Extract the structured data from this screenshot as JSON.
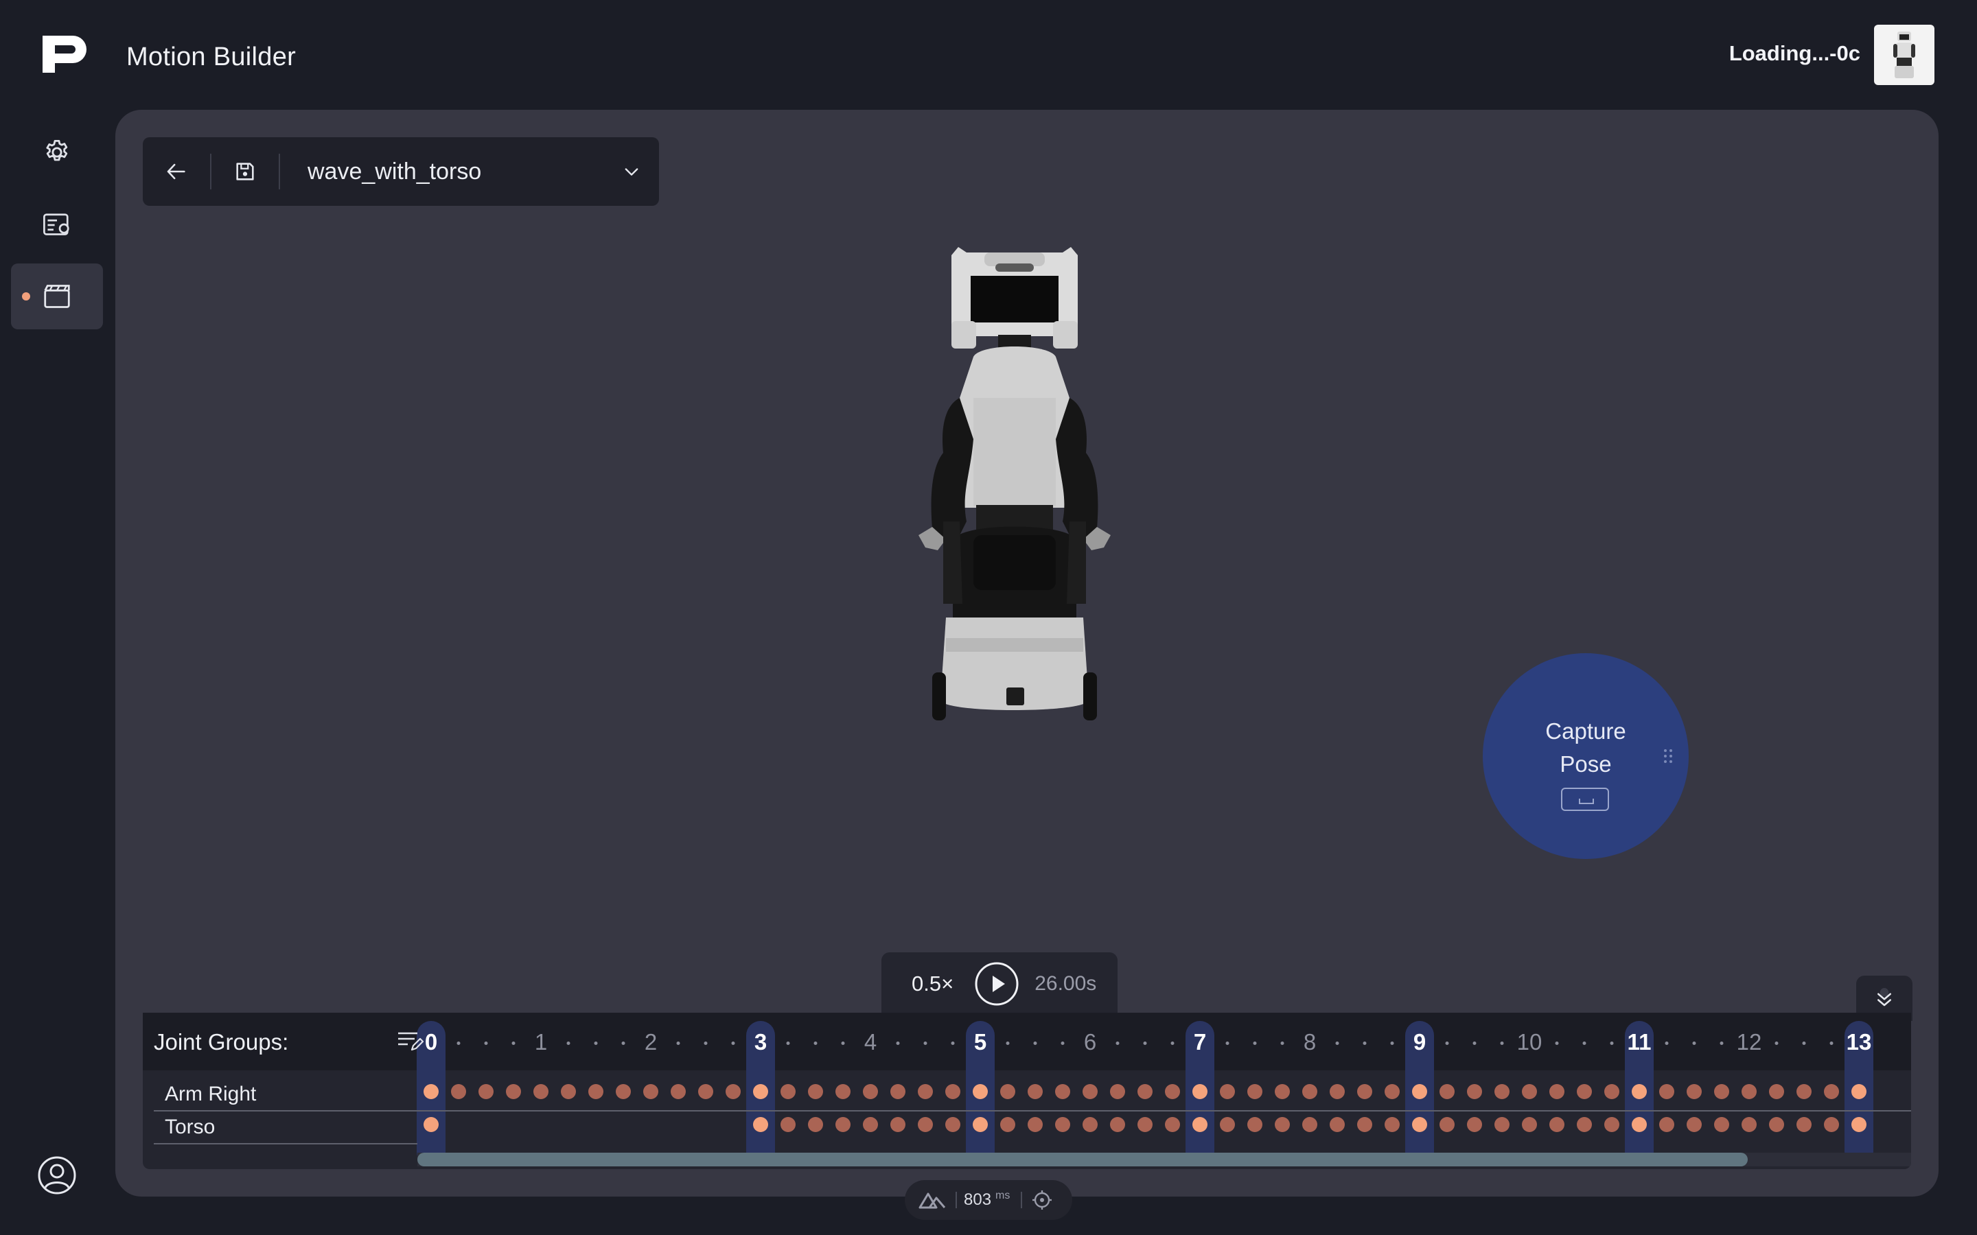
{
  "header": {
    "app_title": "Motion Builder",
    "robot_status": "Loading...-0c",
    "logo_icon": "p-logo-icon",
    "robot_thumb_icon": "robot-thumbnail"
  },
  "sidebar": {
    "items": [
      {
        "name": "settings",
        "icon": "gear-icon"
      },
      {
        "name": "motion-list",
        "icon": "list-settings-icon"
      },
      {
        "name": "motion-builder",
        "icon": "clapperboard-icon",
        "active": true
      }
    ],
    "user_icon": "user-circle-icon"
  },
  "toolbar": {
    "back_icon": "arrow-left-icon",
    "save_icon": "save-icon",
    "motion_name": "wave_with_torso",
    "dropdown_icon": "chevron-down-icon"
  },
  "capture": {
    "line1": "Capture",
    "line2": "Pose",
    "key_icon": "spacebar-icon"
  },
  "playback": {
    "speed": "0.5×",
    "play_icon": "play-icon",
    "duration": "26.00s"
  },
  "timeline": {
    "joint_groups_label": "Joint Groups:",
    "edit_icon": "list-edit-icon",
    "collapse_icon": "chevrons-down-icon",
    "ticks": [
      "0",
      "1",
      "2",
      "3",
      "4",
      "5",
      "6",
      "7",
      "8",
      "9",
      "10",
      "11",
      "12",
      "13"
    ],
    "keyframes": [
      "0",
      "3",
      "5",
      "7",
      "9",
      "11",
      "13"
    ],
    "rows": [
      {
        "label": "Arm Right"
      },
      {
        "label": "Torso"
      }
    ]
  },
  "perf": {
    "ms": "803",
    "unit": "ms",
    "logo_icon": "nuxt-logo-icon",
    "target_icon": "crosshair-icon"
  },
  "colors": {
    "background": "#1b1d26",
    "panel": "#373743",
    "accent_blue": "#2c3f7e",
    "keyframe": "#f5a37c"
  }
}
